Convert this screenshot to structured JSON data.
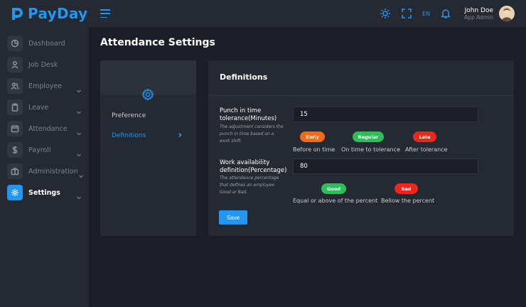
{
  "brand": {
    "name": "PayDay",
    "color": "#2196f3"
  },
  "sidebar": {
    "items": [
      {
        "label": "Dashboard",
        "icon": "dashboard-icon",
        "expandable": false,
        "active": false
      },
      {
        "label": "Job Desk",
        "icon": "user-icon",
        "expandable": false,
        "active": false
      },
      {
        "label": "Employee",
        "icon": "users-icon",
        "expandable": true,
        "active": false
      },
      {
        "label": "Leave",
        "icon": "clipboard-icon",
        "expandable": true,
        "active": false
      },
      {
        "label": "Attendance",
        "icon": "calendar-icon",
        "expandable": true,
        "active": false
      },
      {
        "label": "Payroll",
        "icon": "dollar-icon",
        "expandable": true,
        "active": false
      },
      {
        "label": "Administration",
        "icon": "briefcase-icon",
        "expandable": true,
        "active": false
      },
      {
        "label": "Settings",
        "icon": "gear-icon",
        "expandable": true,
        "active": true
      }
    ]
  },
  "topbar": {
    "language": "EN",
    "user": {
      "name": "John Doe",
      "role": "App Admin"
    }
  },
  "page": {
    "title": "Attendance Settings",
    "tabs": [
      {
        "label": "Preference",
        "active": false
      },
      {
        "label": "Definitions",
        "active": true
      }
    ]
  },
  "definitions": {
    "title": "Definitions",
    "punch": {
      "label": "Punch in time tolerance(Minutes)",
      "help": "The adjustment considers the punch in time based on a work shift.",
      "value": "15",
      "badges": [
        {
          "label": "Early",
          "caption": "Before on time",
          "color": "#f46a1d"
        },
        {
          "label": "Regular",
          "caption": "On time to tolerance",
          "color": "#2ebd59"
        },
        {
          "label": "Late",
          "caption": "After tolerance",
          "color": "#f0261d"
        }
      ]
    },
    "availability": {
      "label": "Work availability definition(Percentage)",
      "help": "The attendance percentage that defines an employee Good or Bad.",
      "value": "80",
      "badges": [
        {
          "label": "Good",
          "caption": "Equal or above of the percent",
          "color": "#2ebd59"
        },
        {
          "label": "Bad",
          "caption": "Bellow the percent",
          "color": "#f0261d"
        }
      ]
    },
    "save_label": "Save"
  }
}
